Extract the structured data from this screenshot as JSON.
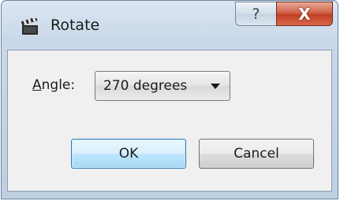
{
  "window": {
    "title": "Rotate",
    "help_glyph": "?",
    "close_glyph": "X",
    "app_icon": "clapperboard-icon"
  },
  "form": {
    "angle_label_accel": "A",
    "angle_label_rest": "ngle:",
    "angle_value": "270 degrees"
  },
  "buttons": {
    "ok": "OK",
    "cancel": "Cancel"
  },
  "colors": {
    "close_button": "#c33f24",
    "default_button_border": "#3c7fb1"
  }
}
